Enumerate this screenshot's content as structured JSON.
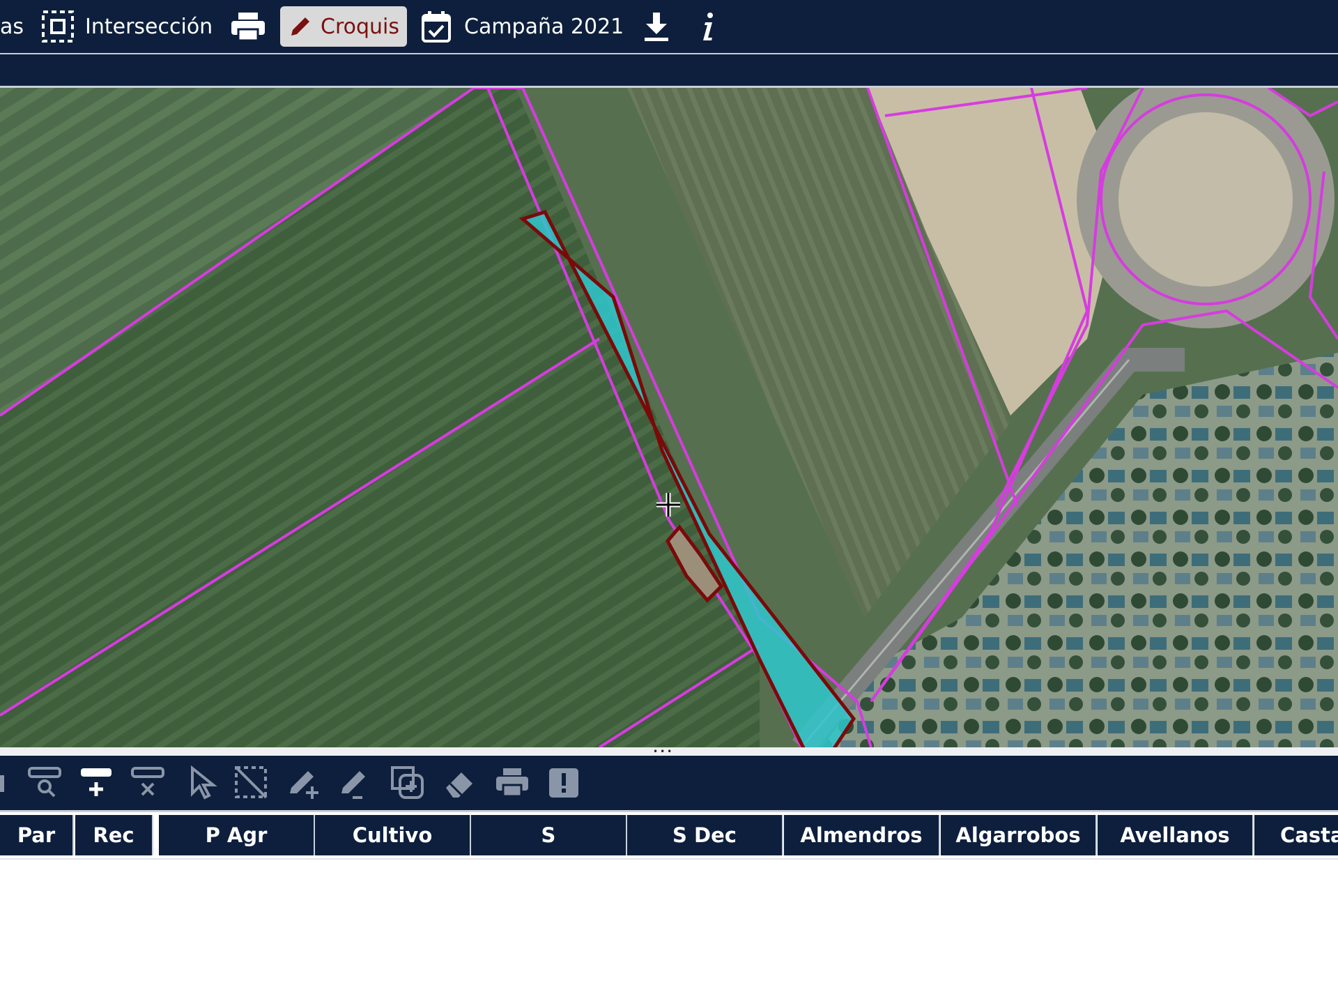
{
  "topbar": {
    "partial_label": "as",
    "intersection_label": "Intersección",
    "croquis_label": "Croquis",
    "campaign_label": "Campaña 2021"
  },
  "table": {
    "columns": [
      "Par",
      "Rec",
      "P Agr",
      "Cultivo",
      "S",
      "S Dec",
      "Almendros",
      "Algarrobos",
      "Avellanos",
      "Casta"
    ]
  },
  "colors": {
    "toolbar_bg": "#0d1f3c",
    "parcel_boundary": "#d63cdf",
    "selected_fill": "#2fc7cd",
    "selected_outline": "#7a0a0a",
    "croquis_text": "#7a1010"
  },
  "icons": {
    "topbar": [
      "selection-box-icon",
      "print-icon",
      "pencil-icon",
      "calendar-check-icon",
      "download-icon",
      "info-icon"
    ],
    "tools": [
      "partial-icon",
      "zoom-to-row-icon",
      "add-row-icon",
      "remove-row-icon",
      "select-pointer-icon",
      "deselect-icon",
      "add-edit-icon",
      "remove-edit-icon",
      "zoom-in-box-icon",
      "eraser-icon",
      "print-icon",
      "alert-icon"
    ]
  }
}
